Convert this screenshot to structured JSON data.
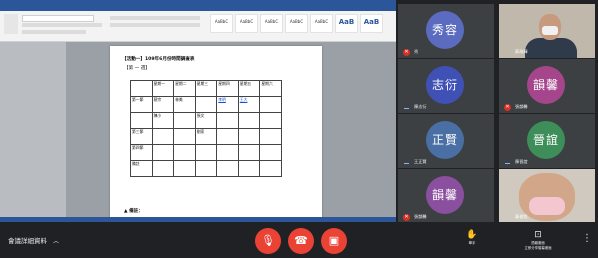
{
  "screen_share": {
    "doc_title": "【活動一】109年6月份時間調查表",
    "doc_subtitle": "【第 一 週】",
    "table_rows": [
      [
        "",
        "星期一",
        "星期二",
        "星期三",
        "星期四",
        "星期五",
        "星期六"
      ],
      [
        "第一節",
        "蔡宗",
        "林美",
        "",
        "李明",
        "王大",
        ""
      ],
      [
        "",
        "陳小",
        "",
        "張文",
        "",
        "",
        ""
      ],
      [
        "第三節",
        "",
        "",
        "劉家",
        "",
        "",
        ""
      ],
      [
        "第四節",
        "",
        "",
        "",
        "",
        "",
        ""
      ],
      [
        "備註",
        "",
        "",
        "",
        "",
        "",
        ""
      ]
    ],
    "highlight_cells": [
      "1-4",
      "1-5"
    ],
    "doc_footer": "▲ 備註："
  },
  "participants": [
    {
      "initials": "秀容",
      "name": "秀",
      "color": "#5b6bbf",
      "muted": true,
      "video": false
    },
    {
      "name": "蔡政輝",
      "video": true,
      "muted": false
    },
    {
      "initials": "志衍",
      "name": "陳志衍",
      "color": "#3f51b5",
      "muted": false,
      "video": false
    },
    {
      "initials": "韻馨",
      "name": "張韻馨",
      "color": "#a5458b",
      "muted": true,
      "video": false
    },
    {
      "initials": "正賢",
      "name": "王正賢",
      "color": "#4a6fa5",
      "muted": false,
      "video": false
    },
    {
      "initials": "晉誼",
      "name": "陳晉誼",
      "color": "#3e8e5a",
      "muted": false,
      "video": false
    },
    {
      "initials": "韻馨",
      "name": "張韻馨",
      "color": "#8b4fa0",
      "muted": true,
      "video": false
    },
    {
      "name": "黃俊銘",
      "video": true,
      "muted": false
    }
  ],
  "controls": {
    "details_label": "會議詳細資料",
    "mic_icon": "mic-off-icon",
    "hangup_icon": "hangup-icon",
    "camera_icon": "camera-off-icon",
    "raise_hand_label": "舉手",
    "present_label": "立即分享螢幕畫面",
    "present_title": "簡報畫面"
  },
  "colors": {
    "end_call": "#ea4335",
    "background": "#202124",
    "tile": "#3c4043",
    "word_blue": "#2b579a"
  }
}
